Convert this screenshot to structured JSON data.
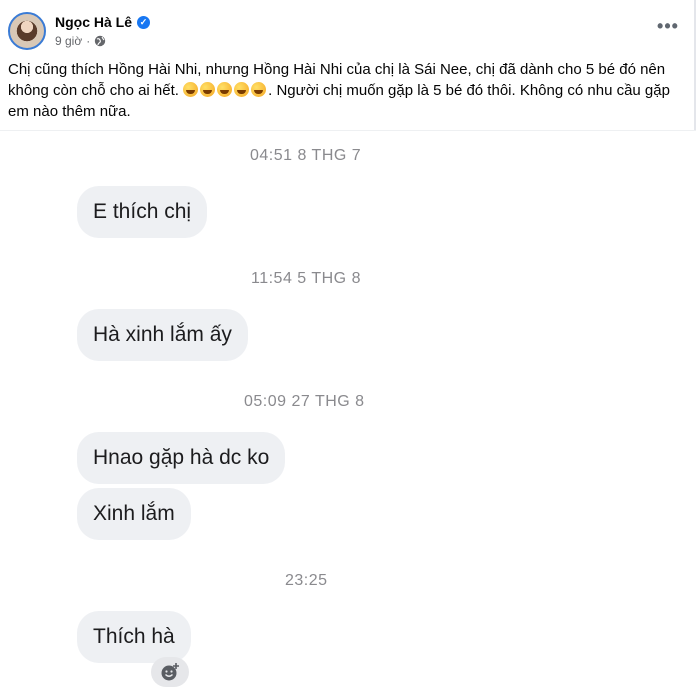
{
  "post": {
    "author": "Ngọc Hà Lê",
    "verified": true,
    "time": "9 giờ",
    "separator": "·",
    "privacy_icon": "globe-icon",
    "caption_part1": "Chị cũng thích Hồng Hài Nhi, nhưng Hồng Hài Nhi của chị là Sái Nee,  chị đã dành cho 5 bé đó nên không còn chỗ cho ai hết.",
    "caption_emoji_count": 5,
    "caption_emoji": "rolling-on-floor-laughing-emoji",
    "caption_part2": ". Người chị muốn gặp là 5 bé đó thôi. Không có nhu cầu gặp em nào thêm nữa."
  },
  "chat": {
    "messages": [
      {
        "type": "timestamp",
        "text": "04:51 8 THG 7"
      },
      {
        "type": "bubble",
        "text": "E thích chị"
      },
      {
        "type": "timestamp",
        "text": "11:54 5 THG 8"
      },
      {
        "type": "bubble",
        "text": "Hà xinh lắm ấy"
      },
      {
        "type": "timestamp",
        "text": "05:09 27 THG 8"
      },
      {
        "type": "bubble",
        "text": "Hnao gặp hà dc ko"
      },
      {
        "type": "bubble",
        "text": "Xinh lắm"
      },
      {
        "type": "timestamp",
        "text": "23:25"
      },
      {
        "type": "bubble",
        "text": "Thích hà"
      }
    ],
    "reaction_icon": "add-reaction-icon"
  },
  "colors": {
    "verified": "#1877f2",
    "bubble": "#eef0f3",
    "timestamp": "#8a8a8e"
  }
}
